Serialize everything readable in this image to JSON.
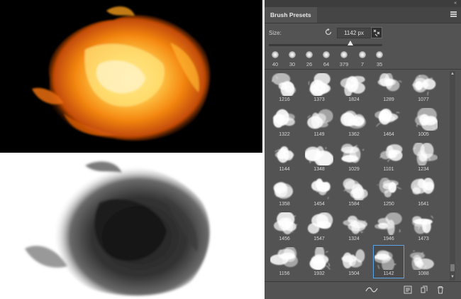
{
  "colors": {
    "panel_bg": "#535353",
    "selection": "#5aa5e6",
    "fire_core": "#ffd050",
    "fire_outer": "#c24a06"
  },
  "panel": {
    "collapse_glyph": "«",
    "tab_label": "Brush Presets",
    "menu_icon": "panel-menu-icon",
    "size_label": "Size:",
    "size_value": "1142 px",
    "size_slider_fraction": 0.72,
    "recent_brushes": [
      "40",
      "30",
      "26",
      "64",
      "379",
      "7",
      "35"
    ],
    "brushes": [
      "1216",
      "1373",
      "1824",
      "1289",
      "1077",
      "1322",
      "1149",
      "1362",
      "1464",
      "1005",
      "1144",
      "1348",
      "1029",
      "1101",
      "1234",
      "1358",
      "1454",
      "1584",
      "1250",
      "1641",
      "1456",
      "1547",
      "1324",
      "1946",
      "1473",
      "1156",
      "1932",
      "1504",
      "1142",
      "1088"
    ],
    "selected_brush": "1142",
    "bottom_icons": [
      "toggle-preview-icon",
      "brush-settings-icon",
      "new-brush-icon",
      "delete-brush-icon"
    ]
  }
}
